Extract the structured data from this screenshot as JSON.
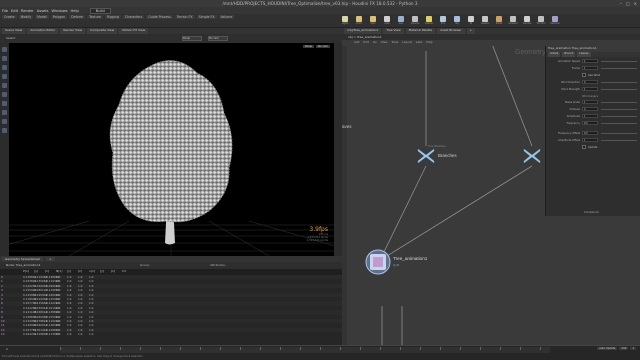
{
  "window": {
    "title": "/mnt/HDD/PROJECTS_HOUDINI/Tree_Optimalize/tree_v03.hip - Houdini FX 18.0.532 - Python 3"
  },
  "menubar": {
    "items": [
      "File",
      "Edit",
      "Render",
      "Assets",
      "Windows",
      "Help"
    ],
    "desktop": "Build"
  },
  "shelf": {
    "tabs": [
      "Create",
      "Modify",
      "Model",
      "Polygon",
      "Deform",
      "Texture",
      "Rigging",
      "Characters",
      "Guide Process",
      "Terrain FX",
      "Simple FX",
      "Volume"
    ],
    "tools": [
      {
        "label": "Lights",
        "color": "#d8d8a0"
      },
      {
        "label": "Point",
        "color": "#e0c070"
      },
      {
        "label": "Spot",
        "color": "#e0c070"
      },
      {
        "label": "Area",
        "color": "#d0d0d0"
      },
      {
        "label": "Geo",
        "color": "#9ab0d0"
      },
      {
        "label": "Volume",
        "color": "#c0c0c0"
      },
      {
        "label": "Distant",
        "color": "#e0d060"
      },
      {
        "label": "Env",
        "color": "#b0c8e0"
      },
      {
        "label": "Sky",
        "color": "#a0c0e0"
      },
      {
        "label": "GI",
        "color": "#d0d0d0"
      },
      {
        "label": "Caustic",
        "color": "#c8c8c8"
      },
      {
        "label": "Portal",
        "color": "#d0a060"
      },
      {
        "label": "Ambient",
        "color": "#c0c0c0"
      },
      {
        "label": "Camera",
        "color": "#d0d0d0"
      },
      {
        "label": "VR Cam",
        "color": "#c0c0c0"
      },
      {
        "label": "Switcher",
        "color": "#a0a0d0"
      }
    ]
  },
  "viewer": {
    "tabs": [
      "Scene View",
      "Animation Editor",
      "Render View",
      "Composite View",
      "Motion FX View"
    ],
    "label": "Select",
    "camera_menu": "Persp",
    "cam_dropdown": "No cam",
    "view_buttons": [
      "Persp",
      "No cam"
    ],
    "fps": "3.9fps",
    "info_lines": [
      "185 ms",
      "2,634,512 prims",
      "1,319,424 points"
    ]
  },
  "spreadsheet": {
    "tabs": [
      "Geometry Spreadsheet",
      "+"
    ],
    "node": "Node: Tree_animation1",
    "group_label": "Group:",
    "attr_label": "Attributes:",
    "columns": [
      "",
      "P[x]",
      "[y]",
      "[z]",
      "N[x]",
      "[y]",
      "[z]",
      "v[x]",
      "[y]",
      "[z]",
      "Cd",
      "",
      ""
    ],
    "rows": [
      [
        "0",
        "0.138811",
        "0.110985",
        "-0.148915",
        "0.0",
        "1.0",
        "1.0",
        "1.0"
      ],
      [
        "1",
        "0.163812",
        "0.130062",
        "-0.110345",
        "0.0",
        "1.0",
        "1.0",
        "1.0"
      ],
      [
        "2",
        "0.140201",
        "0.160048",
        "-0.099020",
        "0.0",
        "1.0",
        "1.0",
        "1.0"
      ],
      [
        "3",
        "0.155920",
        "0.180120",
        "-0.129812",
        "0.0",
        "1.0",
        "1.0",
        "1.0"
      ],
      [
        "4",
        "0.129981",
        "0.190902",
        "-0.160094",
        "0.0",
        "1.0",
        "1.0",
        "1.0"
      ],
      [
        "5",
        "0.118009",
        "0.210092",
        "-0.145902",
        "0.0",
        "1.0",
        "1.0",
        "1.0"
      ],
      [
        "6",
        "0.167720",
        "0.215662",
        "-0.122210",
        "0.0",
        "1.0",
        "1.0",
        "1.0"
      ],
      [
        "7",
        "0.142290",
        "0.230011",
        "-0.101922",
        "0.0",
        "1.0",
        "1.0",
        "1.0"
      ],
      [
        "8",
        "0.121198",
        "0.248012",
        "-0.138892",
        "0.0",
        "1.0",
        "1.0",
        "1.0"
      ],
      [
        "9",
        "0.158830",
        "0.260982",
        "-0.155010",
        "0.0",
        "1.0",
        "1.0",
        "1.0"
      ],
      [
        "10",
        "0.134450",
        "0.278821",
        "-0.119200",
        "0.0",
        "1.0",
        "1.0",
        "1.0"
      ],
      [
        "11",
        "0.149920",
        "0.290012",
        "-0.140029",
        "0.0",
        "1.0",
        "1.0",
        "1.0"
      ],
      [
        "12",
        "0.127781",
        "0.301442",
        "-0.128801",
        "0.0",
        "1.0",
        "1.0",
        "1.0"
      ],
      [
        "13",
        "0.162201",
        "0.318803",
        "-0.113940",
        "0.0",
        "1.0",
        "1.0",
        "1.0"
      ]
    ]
  },
  "network": {
    "tabs": [
      "/obj/Tree_animation1",
      "Tree View",
      "Material Palette",
      "Asset Browser",
      "+"
    ],
    "path": "obj  >  Tree_animation1",
    "menu": [
      "Add",
      "Edit",
      "Go",
      "View",
      "Tools",
      "Layout",
      "Labs",
      "Help"
    ],
    "context_label": "Geometry",
    "nodes": [
      {
        "name": "Branches",
        "sub": "Tree_Branches"
      },
      {
        "name": "",
        "sub": ""
      },
      {
        "name": "Tree_animation1",
        "sub": "Tree_animation"
      }
    ],
    "side_label": "aves"
  },
  "parameters": {
    "header": "Tree_animation   Tree_animation1",
    "tabs": [
      "Global",
      "Branch",
      "Leaves"
    ],
    "rows": [
      {
        "label": "Animation Speed",
        "value": "1",
        "kind": "slider"
      },
      {
        "label": "Frame",
        "value": "1",
        "kind": "slider"
      },
      {
        "label": "Use Wind",
        "value": "",
        "kind": "check"
      },
      {
        "label": "Wind Direction",
        "value": "0",
        "kind": "slider"
      },
      {
        "label": "Wind Strength",
        "value": "1",
        "kind": "slider"
      }
    ],
    "section": "Wind Layers",
    "rows2": [
      {
        "label": "Noise Scale",
        "value": "1",
        "kind": "slider"
      },
      {
        "label": "Octaves",
        "value": "4",
        "kind": "slider"
      },
      {
        "label": "Amplitude",
        "value": "1",
        "kind": "slider"
      },
      {
        "label": "Frequency",
        "value": "0.5",
        "kind": "slider"
      }
    ],
    "rows3": [
      {
        "label": "Frequency Offset",
        "value": "0.5",
        "kind": "slider"
      },
      {
        "label": "Amplitude Offset",
        "value": "1",
        "kind": "slider"
      },
      {
        "label": "Update",
        "value": "",
        "kind": "check"
      }
    ],
    "footer": "Compile All"
  },
  "timeline": {
    "frame": "1",
    "start": "1",
    "end": "240",
    "status": "The left hand selection block (Alt-Shift-Click) is a multipurpose selection. Use drag to change block selection.",
    "controls": [
      "Auto Update",
      "240",
      "1"
    ]
  }
}
